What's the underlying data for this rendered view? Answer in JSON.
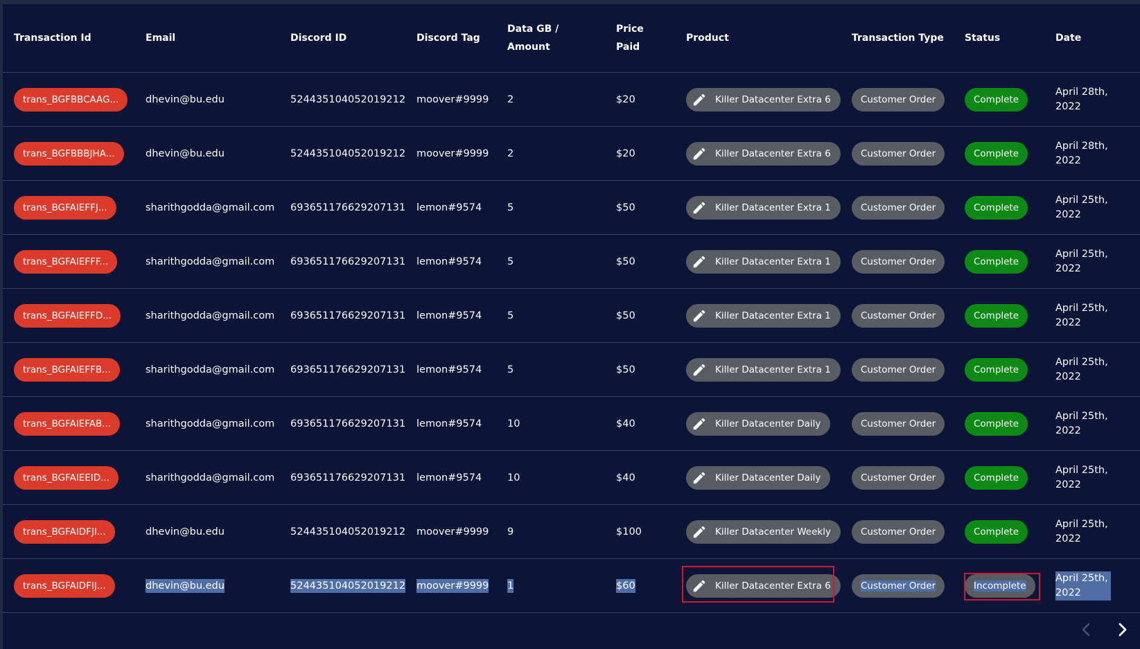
{
  "table": {
    "headers": {
      "transaction_id": "Transaction Id",
      "email": "Email",
      "discord_id": "Discord ID",
      "discord_tag": "Discord Tag",
      "data_amount_line1": "Data GB /",
      "data_amount_line2": "Amount",
      "price_line1": "Price",
      "price_line2": "Paid",
      "product": "Product",
      "transaction_type": "Transaction Type",
      "status": "Status",
      "date": "Date"
    },
    "rows": [
      {
        "transaction_id": "trans_BGFBBCAAG...",
        "email": "dhevin@bu.edu",
        "discord_id": "524435104052019212",
        "discord_tag": "moover#9999",
        "data_amount": "2",
        "price": "$20",
        "product": "Killer Datacenter Extra 6",
        "transaction_type": "Customer Order",
        "status": "Complete",
        "date": "April 28th, 2022"
      },
      {
        "transaction_id": "trans_BGFBBBJHA...",
        "email": "dhevin@bu.edu",
        "discord_id": "524435104052019212",
        "discord_tag": "moover#9999",
        "data_amount": "2",
        "price": "$20",
        "product": "Killer Datacenter Extra 6",
        "transaction_type": "Customer Order",
        "status": "Complete",
        "date": "April 28th, 2022"
      },
      {
        "transaction_id": "trans_BGFAIEFFJ...",
        "email": "sharithgodda@gmail.com",
        "discord_id": "693651176629207131",
        "discord_tag": "lemon#9574",
        "data_amount": "5",
        "price": "$50",
        "product": "Killer Datacenter Extra 1",
        "transaction_type": "Customer Order",
        "status": "Complete",
        "date": "April 25th, 2022"
      },
      {
        "transaction_id": "trans_BGFAIEFFF...",
        "email": "sharithgodda@gmail.com",
        "discord_id": "693651176629207131",
        "discord_tag": "lemon#9574",
        "data_amount": "5",
        "price": "$50",
        "product": "Killer Datacenter Extra 1",
        "transaction_type": "Customer Order",
        "status": "Complete",
        "date": "April 25th, 2022"
      },
      {
        "transaction_id": "trans_BGFAIEFFD...",
        "email": "sharithgodda@gmail.com",
        "discord_id": "693651176629207131",
        "discord_tag": "lemon#9574",
        "data_amount": "5",
        "price": "$50",
        "product": "Killer Datacenter Extra 1",
        "transaction_type": "Customer Order",
        "status": "Complete",
        "date": "April 25th, 2022"
      },
      {
        "transaction_id": "trans_BGFAIEFFB...",
        "email": "sharithgodda@gmail.com",
        "discord_id": "693651176629207131",
        "discord_tag": "lemon#9574",
        "data_amount": "5",
        "price": "$50",
        "product": "Killer Datacenter Extra 1",
        "transaction_type": "Customer Order",
        "status": "Complete",
        "date": "April 25th, 2022"
      },
      {
        "transaction_id": "trans_BGFAIEFAB...",
        "email": "sharithgodda@gmail.com",
        "discord_id": "693651176629207131",
        "discord_tag": "lemon#9574",
        "data_amount": "10",
        "price": "$40",
        "product": "Killer Datacenter Daily",
        "transaction_type": "Customer Order",
        "status": "Complete",
        "date": "April 25th, 2022"
      },
      {
        "transaction_id": "trans_BGFAIEEID...",
        "email": "sharithgodda@gmail.com",
        "discord_id": "693651176629207131",
        "discord_tag": "lemon#9574",
        "data_amount": "10",
        "price": "$40",
        "product": "Killer Datacenter Daily",
        "transaction_type": "Customer Order",
        "status": "Complete",
        "date": "April 25th, 2022"
      },
      {
        "transaction_id": "trans_BGFAIDFJI...",
        "email": "dhevin@bu.edu",
        "discord_id": "524435104052019212",
        "discord_tag": "moover#9999",
        "data_amount": "9",
        "price": "$100",
        "product": "Killer Datacenter Weekly",
        "transaction_type": "Customer Order",
        "status": "Complete",
        "date": "April 25th, 2022"
      },
      {
        "transaction_id": "trans_BGFAIDFIJ...",
        "email": "dhevin@bu.edu",
        "discord_id": "524435104052019212",
        "discord_tag": "moover#9999",
        "data_amount": "1",
        "price": "$60",
        "product": "Killer Datacenter Extra 6",
        "transaction_type": "Customer Order",
        "status": "Incomplete",
        "date": "April 25th, 2022"
      }
    ]
  },
  "icons": {
    "product_edit": "pencil-icon",
    "prev_page": "chevron-left-icon",
    "next_page": "chevron-right-icon"
  },
  "colors": {
    "background": "#0c1437",
    "transaction_pill": "#dc3b2b",
    "status_complete": "#0d8a16",
    "neutral_pill": "#5a5c63",
    "selection": "#4f6ea8",
    "highlight_box": "#d4172a"
  }
}
